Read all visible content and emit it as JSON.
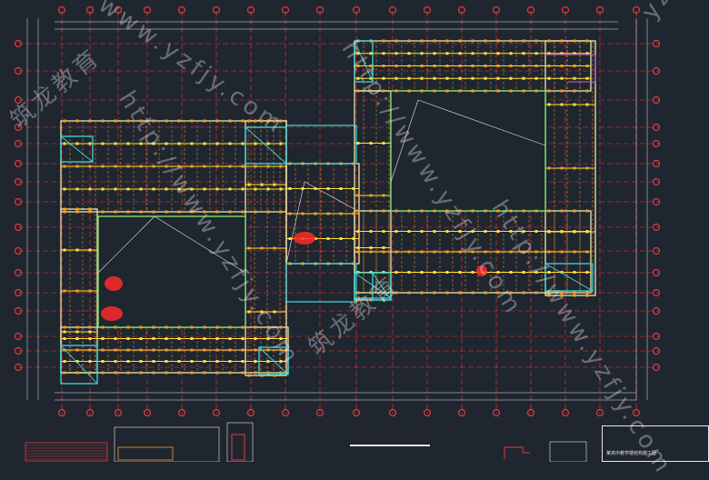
{
  "drawing": {
    "background": "#1f2630",
    "colors": {
      "axis": "#e23b3b",
      "grid": "#ff3030",
      "wall": "#e6e6a8",
      "column": "#ffe23a",
      "column_alt": "#ff9a1a",
      "cyan": "#3fd8d8",
      "white": "#e8e8e8",
      "magenta": "#d45ad4",
      "green": "#78e06a",
      "hatch": "#ff2a2a"
    },
    "watermarks": [
      {
        "id": "wm-1",
        "text": "http://www.yzfjy.com"
      },
      {
        "id": "wm-2",
        "text": "http://www.yzfjy.com"
      },
      {
        "id": "wm-3",
        "text": "http://www.yzfjy.com"
      },
      {
        "id": "wm-4",
        "text": "www.yzfjy.com"
      },
      {
        "id": "wm-5",
        "text": "筑龙教育"
      },
      {
        "id": "wm-6",
        "text": "筑龙教育"
      },
      {
        "id": "wm-7",
        "text": "yzfjy.com"
      }
    ],
    "title_block_text": "某高中教学楼结构施工图"
  }
}
